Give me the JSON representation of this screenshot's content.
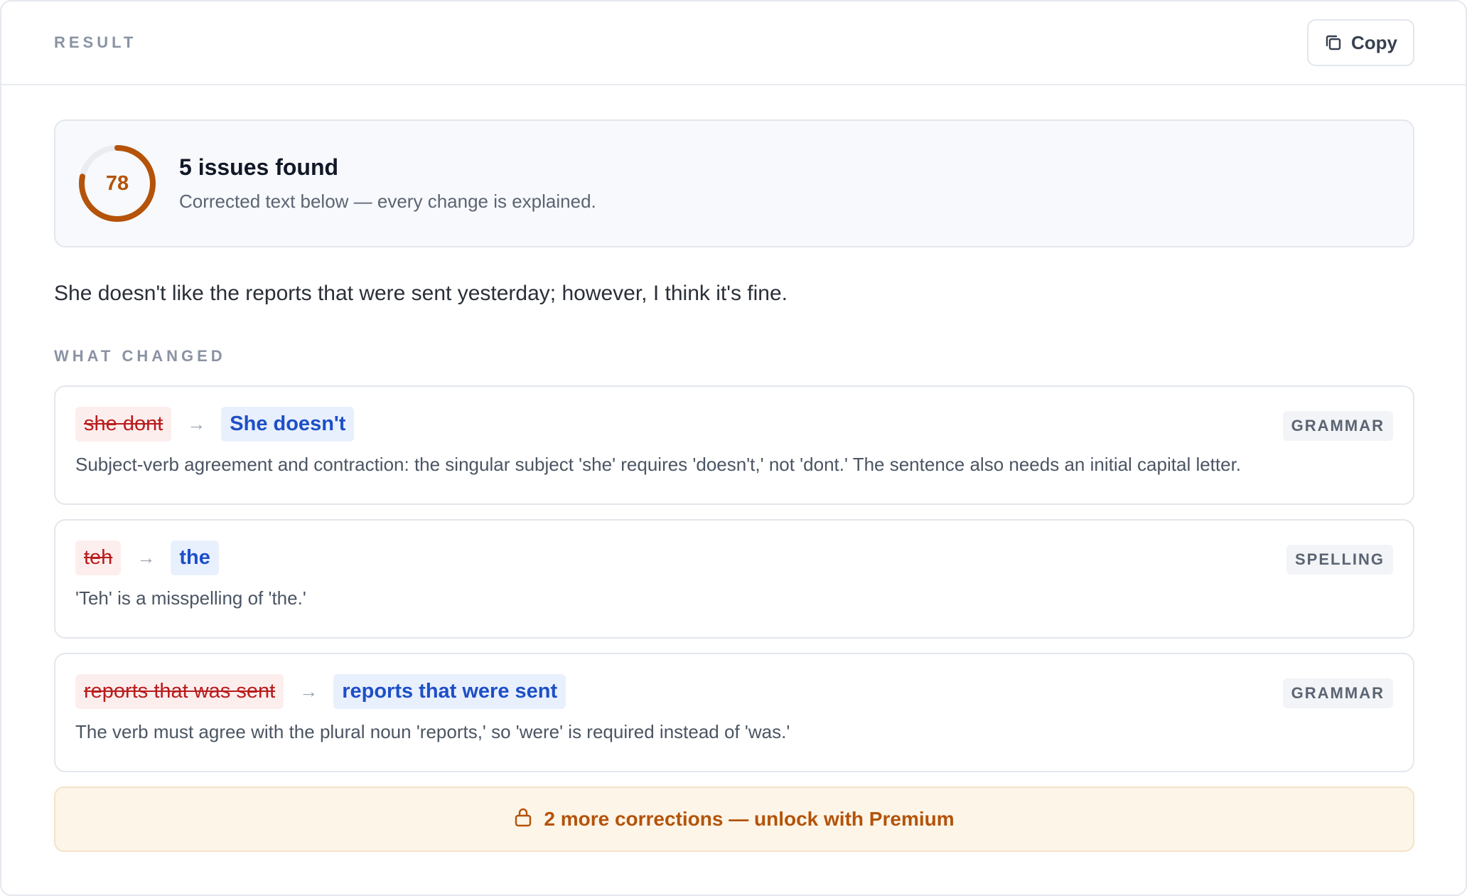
{
  "header": {
    "label": "RESULT",
    "copy_label": "Copy",
    "copy_icon": "copy-icon"
  },
  "summary": {
    "score": 78,
    "score_fraction": 0.78,
    "title": "5 issues found",
    "subtitle": "Corrected text below — every change is explained."
  },
  "corrected_text": "She doesn't like the reports that were sent yesterday; however, I think it's fine.",
  "changes_section": {
    "label": "WHAT CHANGED",
    "items": [
      {
        "original": "she dont",
        "replacement": "She doesn't",
        "category": "GRAMMAR",
        "explanation": "Subject-verb agreement and contraction: the singular subject 'she' requires 'doesn't,' not 'dont.' The sentence also needs an initial capital letter."
      },
      {
        "original": "teh",
        "replacement": "the",
        "category": "SPELLING",
        "explanation": "'Teh' is a misspelling of 'the.'"
      },
      {
        "original": "reports that was sent",
        "replacement": "reports that were sent",
        "category": "GRAMMAR",
        "explanation": "The verb must agree with the plural noun 'reports,' so 'were' is required instead of 'was.'"
      }
    ]
  },
  "premium": {
    "label": "2 more corrections — unlock with Premium",
    "icon": "lock-icon"
  },
  "colors": {
    "score_arc": "#b45309",
    "score_track": "#e9ecf1",
    "old_text": "#b91c1c",
    "new_text": "#1d4fc7",
    "premium_text": "#b45309"
  },
  "icons": {
    "arrow": "→"
  }
}
